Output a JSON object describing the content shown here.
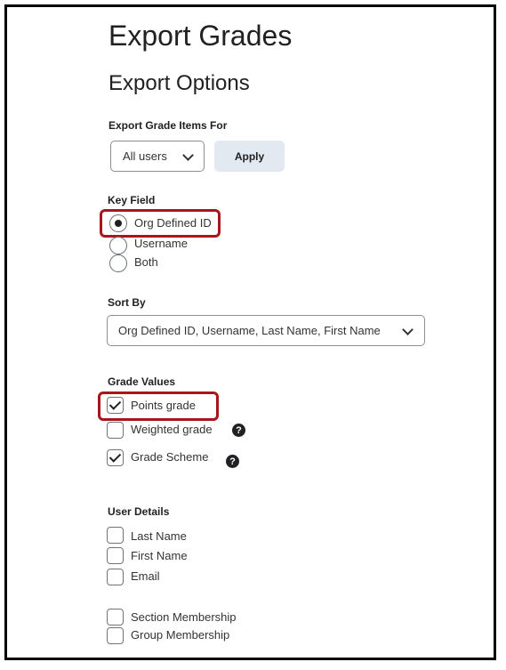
{
  "page": {
    "title": "Export Grades",
    "subtitle": "Export Options"
  },
  "export_for": {
    "label": "Export Grade Items For",
    "selected": "All users",
    "apply_label": "Apply"
  },
  "key_field": {
    "label": "Key Field",
    "options": [
      {
        "label": "Org Defined ID",
        "selected": true
      },
      {
        "label": "Username",
        "selected": false
      },
      {
        "label": "Both",
        "selected": false
      }
    ]
  },
  "sort_by": {
    "label": "Sort By",
    "selected": "Org Defined ID, Username, Last Name, First Name"
  },
  "grade_values": {
    "label": "Grade Values",
    "options": [
      {
        "label": "Points grade",
        "checked": true,
        "help": false
      },
      {
        "label": "Weighted grade",
        "checked": false,
        "help": true
      },
      {
        "label": "Grade Scheme",
        "checked": true,
        "help": true
      }
    ]
  },
  "user_details": {
    "label": "User Details",
    "options": [
      {
        "label": "Last Name",
        "checked": false
      },
      {
        "label": "First Name",
        "checked": false
      },
      {
        "label": "Email",
        "checked": false
      },
      {
        "label": "Section Membership",
        "checked": false
      },
      {
        "label": "Group Membership",
        "checked": false
      }
    ]
  },
  "help_glyph": "?",
  "colors": {
    "highlight": "#a8161b",
    "button_bg": "#e3e9f1"
  }
}
